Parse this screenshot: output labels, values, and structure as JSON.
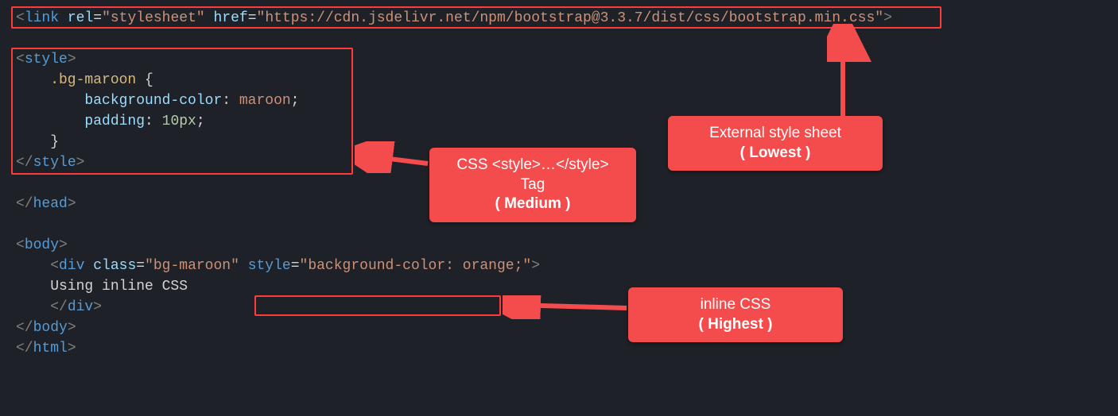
{
  "code": {
    "link_open_bracket": "<",
    "link_tag": "link",
    "link_attr_rel": "rel",
    "link_rel_val": "\"stylesheet\"",
    "link_attr_href": "href",
    "link_href_val": "\"https://cdn.jsdelivr.net/npm/bootstrap@3.3.7/dist/css/bootstrap.min.css\"",
    "link_close_bracket": ">",
    "style_open": "<style>",
    "style_sel": "    .bg-maroon",
    "style_brace_open": " {",
    "style_bg_prop": "        background-color",
    "style_bg_val": "maroon",
    "style_pad_prop": "        padding",
    "style_pad_val": "10px",
    "style_brace_close": "    }",
    "style_close": "</style>",
    "head_close": "</head>",
    "body_open": "<body>",
    "div_open_bracket": "    <",
    "div_tag": "div",
    "div_attr_class": "class",
    "div_class_val": "\"bg-maroon\"",
    "div_attr_style": "style",
    "div_style_val": "\"background-color: orange;\"",
    "div_close_bracket": ">",
    "div_text": "    Using inline CSS",
    "div_end": "    </div>",
    "body_close": "</body>",
    "html_close": "</html>"
  },
  "callouts": {
    "external": {
      "title": "External style sheet",
      "sub": "( Lowest )"
    },
    "styletag": {
      "title": "CSS <style>…</style> Tag",
      "sub": "( Medium )"
    },
    "inline": {
      "title": "inline CSS",
      "sub": "( Highest )"
    }
  }
}
